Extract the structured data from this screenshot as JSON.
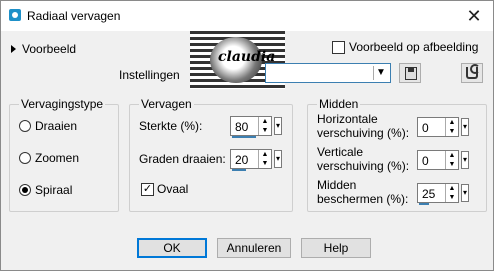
{
  "window": {
    "title": "Radiaal vervagen",
    "close_symbol": "✕"
  },
  "preview": {
    "toggle_label": "Voorbeeld",
    "logo_text": "claudia"
  },
  "preview_on_image": {
    "label": "Voorbeeld op afbeelding",
    "checked": false
  },
  "settings": {
    "label": "Instellingen",
    "value": ""
  },
  "blur_type": {
    "title": "Vervagingstype",
    "options": [
      "Draaien",
      "Zoomen",
      "Spiraal"
    ],
    "selected": "Spiraal"
  },
  "blur": {
    "title": "Vervagen",
    "strength_label": "Sterkte (%):",
    "strength_value": "80",
    "rotate_label": "Graden draaien:",
    "rotate_value": "20",
    "oval_label": "Ovaal",
    "oval_checked": true
  },
  "center": {
    "title": "Midden",
    "h_offset_label_1": "Horizontale",
    "h_offset_label_2": "verschuiving (%):",
    "h_offset_value": "0",
    "v_offset_label_1": "Verticale",
    "v_offset_label_2": "verschuiving (%):",
    "v_offset_value": "0",
    "protect_label_1": "Midden",
    "protect_label_2": "beschermen (%):",
    "protect_value": "25"
  },
  "buttons": {
    "ok": "OK",
    "cancel": "Annuleren",
    "help": "Help"
  },
  "colors": {
    "accent": "#0078d7",
    "slider_fill": "#3c7fb1"
  }
}
